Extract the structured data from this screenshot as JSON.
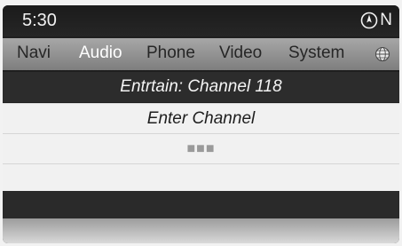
{
  "status": {
    "time": "5:30",
    "compass_heading": "N",
    "icons": {
      "compass": "compass-icon"
    }
  },
  "menu": {
    "items": [
      {
        "label": "Navi"
      },
      {
        "label": "Audio"
      },
      {
        "label": "Phone"
      },
      {
        "label": "Video"
      },
      {
        "label": "System"
      }
    ],
    "active": "Audio",
    "icons": {
      "globe": "globe-icon"
    }
  },
  "screen": {
    "header": "Entrtain: Channel 118",
    "title": "Enter Channel",
    "input_value": "■■■"
  },
  "colors": {
    "background": "#1f1f1f",
    "menu_bar": "#8f8f8f",
    "active_menu_text": "#ffffff",
    "row_bg": "#f1f1f1"
  }
}
